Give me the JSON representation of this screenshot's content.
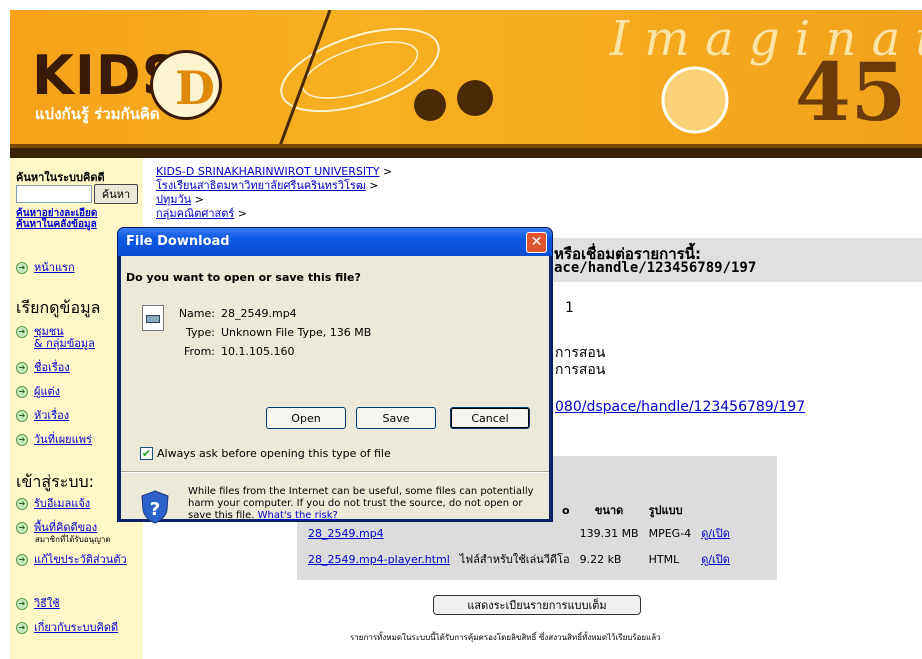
{
  "banner": {
    "logo_text": "KIDS",
    "logo_letter": "D",
    "tagline": "แบ่งกันรู้ ร่วมกันคิด"
  },
  "sidebar": {
    "search_title": "ค้นหาในระบบคิดดี",
    "search_button": "ค้นหา",
    "advanced_search": "ค้นหาอย่างละเอียด",
    "fulltext_search": "ค้นหาในคลังข้อมูล",
    "home": "หน้าแรก",
    "browse_heading": "เรียกดูข้อมูล",
    "browse_items": [
      "ชุมชน",
      "& กลุ่มข้อมูล",
      "ชื่อเรื่อง",
      "ผู้แต่ง",
      "หัวเรื่อง",
      "วันที่เผยแพร่"
    ],
    "login_heading": "เข้าสู่ระบบ:",
    "login_items": [
      "รับอีเมลแจ้ง",
      "พื้นที่คิดดีของ",
      "แก้ไขประวัติส่วนตัว"
    ],
    "members_note": "สมาชิกที่ได้รับอนุญาต",
    "help": "วิธีใช้",
    "about": "เกี่ยวกับระบบคิดดี"
  },
  "breadcrumb": {
    "level1": "KIDS-D SRINAKHARINWIROT UNIVERSITY",
    "level2": "โรงเรียนสาธิตมหาวิทยาลัยศรีนครินทรวิโรฒ",
    "level3": "ปทุมวัน",
    "level4": "กลุ่มคณิตศาสตร์",
    "sep": ">"
  },
  "main": {
    "cite_label": "หรือเชื่อมต่อรายการนี้:",
    "cite_handle": "ace/handle/123456789/197",
    "one": "1",
    "teach1": "การสอน",
    "teach2": "การสอน",
    "url": "080/dspace/handle/123456789/197",
    "full_record_button": "แสดงระเบียนรายการแบบเต็ม",
    "copyright": "รายการทั้งหมดในระบบนี้ได้รับการคุ้มครองโดยลิขสิทธิ์ ซึ่งสงวนสิทธิ์ทั้งหมดไว้เรียบร้อยแล้ว"
  },
  "files": {
    "headers": [
      "ขนาด",
      "รูปแบบ"
    ],
    "header_prefix": "o",
    "rows": [
      {
        "name": "28_2549.mp4",
        "desc": "",
        "size": "139.31 MB",
        "format": "MPEG-4",
        "action": "ดู/เปิด"
      },
      {
        "name": "28_2549.mp4-player.html",
        "desc": "ไฟล์สำหรับใช้เล่นวีดีโอ",
        "size": "9.22 kB",
        "format": "HTML",
        "action": "ดู/เปิด"
      }
    ]
  },
  "dialog": {
    "title": "File Download",
    "close": "✕",
    "question": "Do you want to open or save this file?",
    "name_label": "Name:",
    "name_value": "28_2549.mp4",
    "type_label": "Type:",
    "type_value": "Unknown File Type, 136 MB",
    "from_label": "From:",
    "from_value": "10.1.105.160",
    "open_button": "Open",
    "save_button": "Save",
    "cancel_button": "Cancel",
    "checkbox_label": "Always ask before opening this type of file",
    "checkbox_checked": true,
    "warning_text": "While files from the Internet can be useful, some files can potentially harm your computer. If you do not trust the source, do not open or save this file.",
    "risk_link": "What's the risk?"
  },
  "colors": {
    "banner_orange": "#f6a21a",
    "sidebar_bg": "#fff7c8",
    "dialog_titlebar": "#0a57e4",
    "dialog_body": "#ece9d8"
  }
}
